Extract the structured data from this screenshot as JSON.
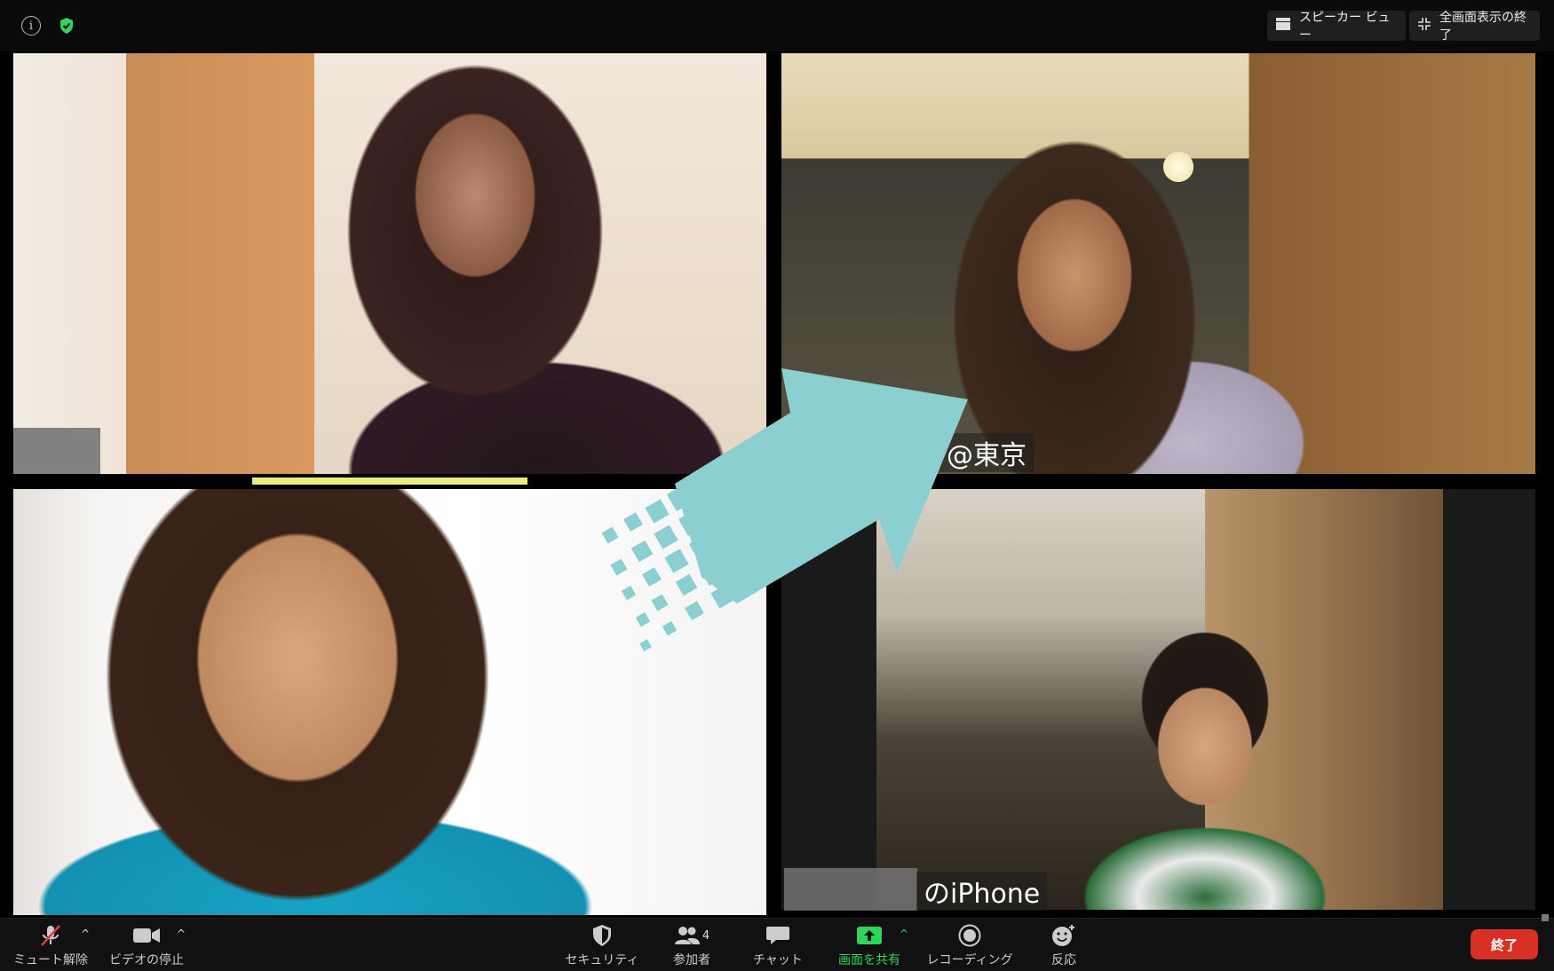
{
  "topbar": {
    "speaker_view_label": "スピーカー ビュー",
    "exit_fullscreen_label": "全画面表示の終了",
    "info_icon": "i",
    "security_icon": "shield-check-icon"
  },
  "tiles": [
    {
      "name": ""
    },
    {
      "name": "@東京"
    },
    {
      "name": ""
    },
    {
      "name": "のiPhone"
    }
  ],
  "toolbar": {
    "mute_label": "ミュート解除",
    "video_label": "ビデオの停止",
    "security_label": "セキュリティ",
    "participants_label": "参加者",
    "participants_count": "4",
    "chat_label": "チャット",
    "share_label": "画面を共有",
    "record_label": "レコーディング",
    "reactions_label": "反応",
    "end_label": "終了"
  },
  "colors": {
    "share_green": "#2fd45a",
    "end_red": "#d93025",
    "active_speaker_yellow": "#ecec7a",
    "arrow_teal": "#8ccfd0"
  }
}
